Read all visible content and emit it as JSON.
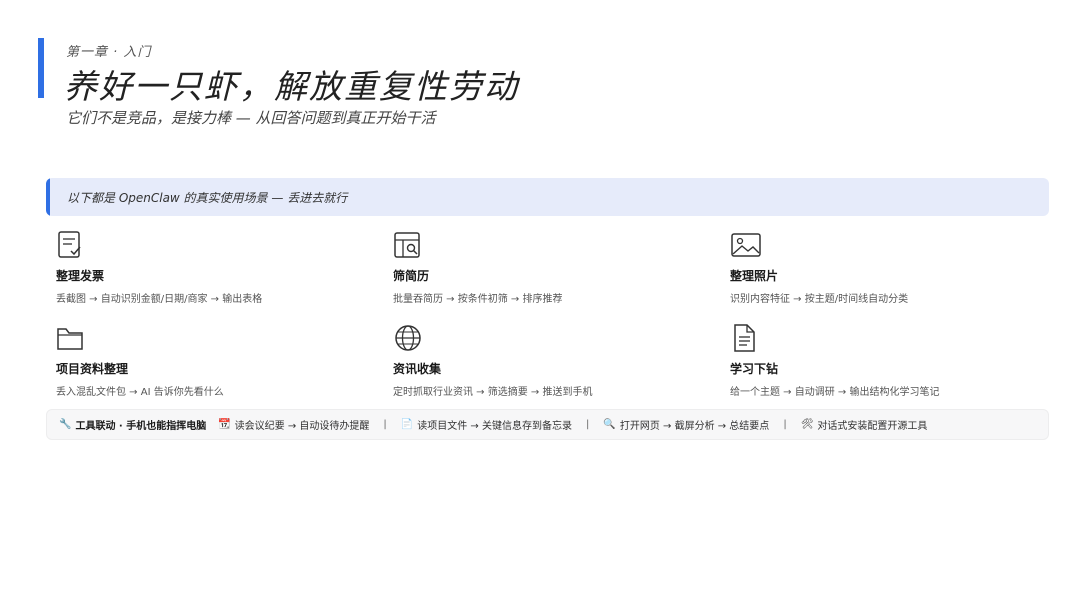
{
  "header": {
    "chapter": "第一章 · 入门",
    "title": "养好一只虾，解放重复性劳动",
    "subtitle": "它们不是竞品，是接力棒 — 从回答问题到真正开始干活"
  },
  "banner": {
    "text": "以下都是 OpenClaw 的真实使用场景 — 丢进去就行"
  },
  "cards": [
    {
      "icon": "receipt-icon",
      "title": "整理发票",
      "desc": "丢截图 → 自动识别金额/日期/商家 → 输出表格"
    },
    {
      "icon": "resume-search-icon",
      "title": "筛简历",
      "desc": "批量吞简历 → 按条件初筛 → 排序推荐"
    },
    {
      "icon": "image-icon",
      "title": "整理照片",
      "desc": "识别内容特征 → 按主题/时间线自动分类"
    },
    {
      "icon": "folder-icon",
      "title": "项目资料整理",
      "desc": "丢入混乱文件包 → AI 告诉你先看什么"
    },
    {
      "icon": "globe-icon",
      "title": "资讯收集",
      "desc": "定时抓取行业资讯 → 筛选摘要 → 推送到手机"
    },
    {
      "icon": "document-icon",
      "title": "学习下钻",
      "desc": "给一个主题 → 自动调研 → 输出结构化学习笔记"
    }
  ],
  "toolbar": {
    "lead_icon": "🔧",
    "lead": "工具联动 · 手机也能指挥电脑",
    "separator": "|",
    "items": [
      {
        "icon": "📆",
        "text": "读会议纪要 → 自动设待办提醒"
      },
      {
        "icon": "📄",
        "text": "读项目文件 → 关键信息存到备忘录"
      },
      {
        "icon": "🔍",
        "text": "打开网页 → 截屏分析 → 总结要点"
      },
      {
        "icon": "🛠",
        "text": "对话式安装配置开源工具"
      }
    ]
  },
  "colors": {
    "accent": "#2f6fe4",
    "banner_bg": "#e6ebfa"
  }
}
